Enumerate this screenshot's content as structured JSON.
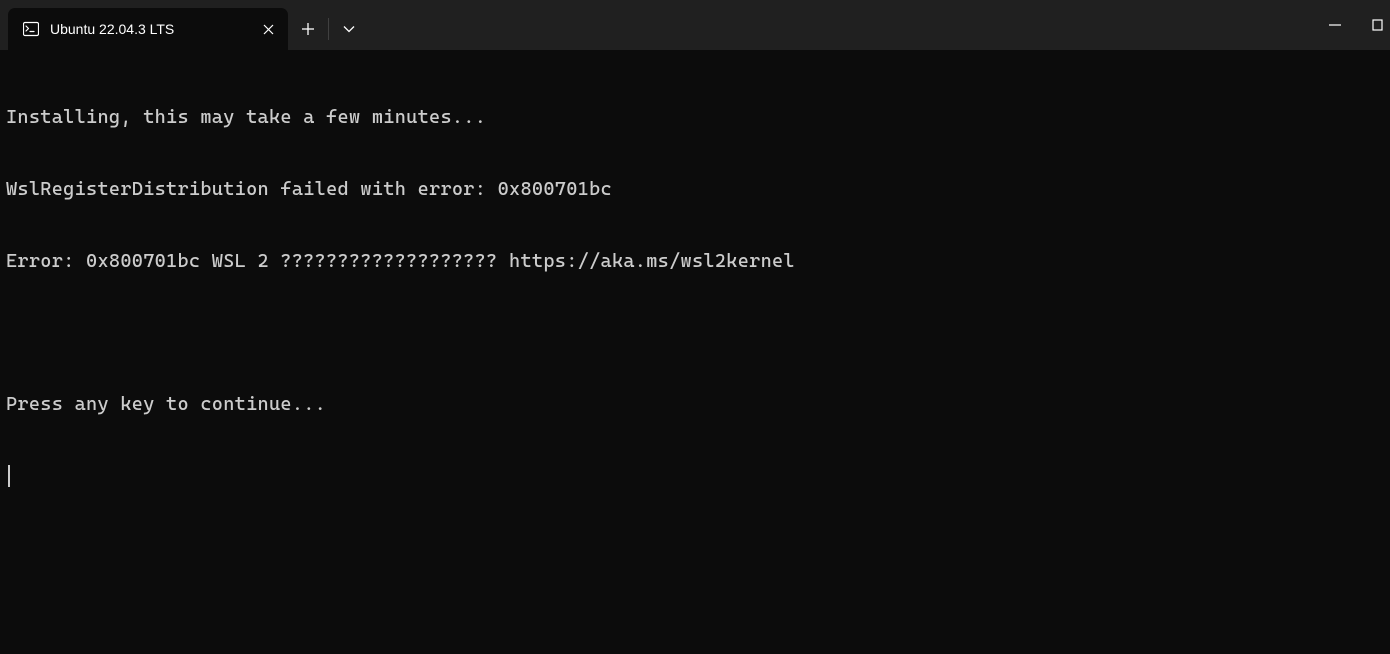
{
  "tab": {
    "title": "Ubuntu 22.04.3 LTS"
  },
  "terminal": {
    "lines": [
      "Installing, this may take a few minutes...",
      "WslRegisterDistribution failed with error: 0x800701bc",
      "Error: 0x800701bc WSL 2 ??????????????????? https://aka.ms/wsl2kernel",
      "",
      "Press any key to continue..."
    ]
  }
}
